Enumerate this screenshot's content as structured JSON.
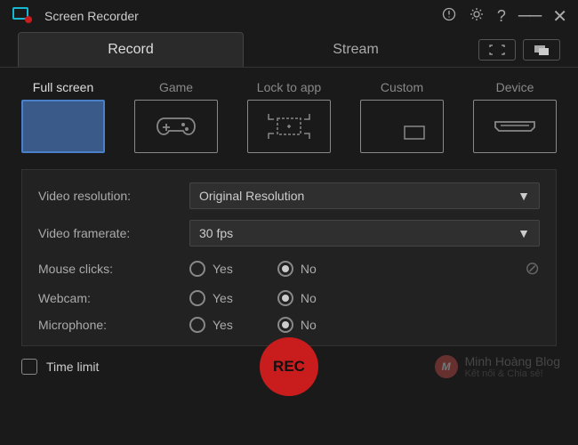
{
  "app": {
    "title": "Screen Recorder"
  },
  "tabs": {
    "record": "Record",
    "stream": "Stream"
  },
  "modes": {
    "full_screen": "Full screen",
    "game": "Game",
    "lock_to_app": "Lock to app",
    "custom": "Custom",
    "device": "Device"
  },
  "settings": {
    "resolution_label": "Video resolution:",
    "resolution_value": "Original Resolution",
    "framerate_label": "Video framerate:",
    "framerate_value": "30 fps",
    "mouse_label": "Mouse clicks:",
    "webcam_label": "Webcam:",
    "mic_label": "Microphone:",
    "yes": "Yes",
    "no": "No"
  },
  "footer": {
    "time_limit": "Time limit",
    "rec": "REC"
  },
  "watermark": {
    "title": "Minh Hoàng Blog",
    "subtitle": "Kết nối & Chia sẻ!",
    "logo_char": "M"
  }
}
